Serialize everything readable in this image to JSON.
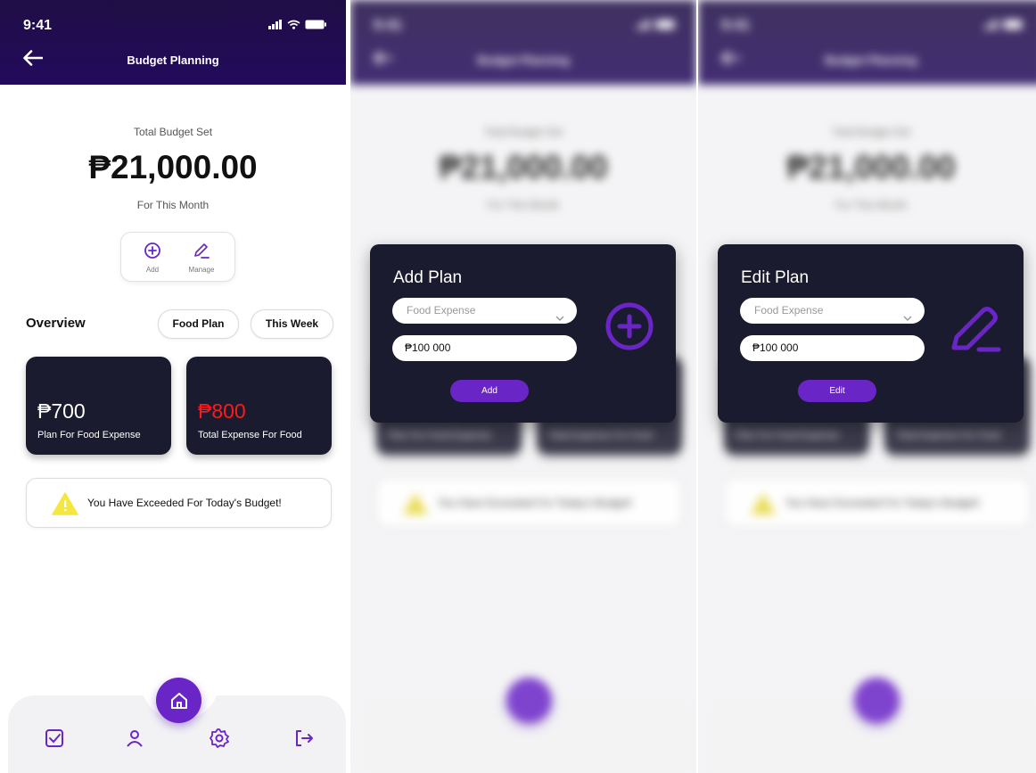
{
  "status": {
    "time": "9:41"
  },
  "app": {
    "title": "Budget Planning"
  },
  "budget": {
    "label": "Total Budget Set",
    "amount": "₱21,000.00",
    "period": "For This Month"
  },
  "actions": {
    "add_label": "Add",
    "manage_label": "Manage"
  },
  "overview": {
    "title": "Overview",
    "chip_category": "Food Plan",
    "chip_period": "This Week"
  },
  "cards": [
    {
      "value": "₱700",
      "caption": "Plan For Food Expense",
      "value_color": "#ffffff"
    },
    {
      "value": "₱800",
      "caption": "Total Expense For Food",
      "value_color": "#ff1a1a"
    }
  ],
  "alert": {
    "text": "You Have Exceeded For Today's Budget!"
  },
  "nav": {
    "items": [
      "tasks-icon",
      "user-icon",
      "settings-icon",
      "logout-icon"
    ],
    "center": "home-icon"
  },
  "add_modal": {
    "title": "Add Plan",
    "category_placeholder": "Food Expense",
    "amount_value": "₱100 000",
    "button_label": "Add"
  },
  "edit_modal": {
    "title": "Edit Plan",
    "category_placeholder": "Food Expense",
    "amount_value": "₱100 000",
    "button_label": "Edit"
  },
  "colors": {
    "accent": "#6a25c7",
    "header": "#230a5c",
    "card": "#1b1b2f",
    "warning": "#f5e642",
    "danger": "#ff1a1a"
  }
}
